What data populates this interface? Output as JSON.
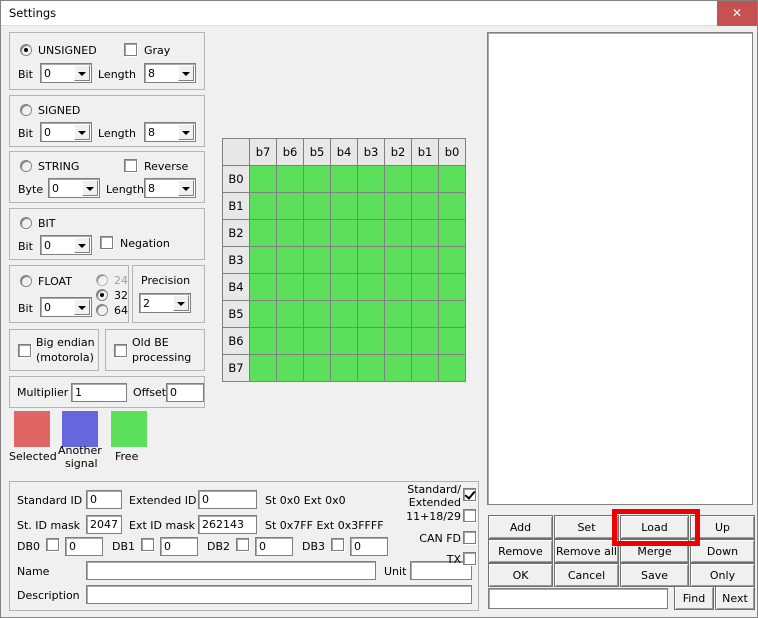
{
  "window": {
    "title": "Settings",
    "close_icon": "close-icon",
    "close_label": "✕"
  },
  "signal_types": {
    "unsigned": {
      "label": "UNSIGNED",
      "selected": true,
      "bit_label": "Bit",
      "bit_value": "0",
      "length_label": "Length",
      "length_value": "8",
      "gray_label": "Gray",
      "gray_checked": false
    },
    "signed": {
      "label": "SIGNED",
      "selected": false,
      "bit_label": "Bit",
      "bit_value": "0",
      "length_label": "Length",
      "length_value": "8"
    },
    "string": {
      "label": "STRING",
      "selected": false,
      "byte_label": "Byte",
      "byte_value": "0",
      "length_label": "Length",
      "length_value": "8",
      "reverse_label": "Reverse",
      "reverse_checked": false
    },
    "bit": {
      "label": "BIT",
      "selected": false,
      "bit_label": "Bit",
      "bit_value": "0",
      "negation_label": "Negation",
      "negation_checked": false
    },
    "float": {
      "label": "FLOAT",
      "selected": false,
      "bit_label": "Bit",
      "bit_value": "0",
      "width_options": [
        "24",
        "32",
        "64"
      ],
      "width_selected": "32",
      "width_24_disabled": true,
      "precision_label": "Precision",
      "precision_value": "2"
    }
  },
  "endian": {
    "big_endian_label": "Big endian (motorola)",
    "big_endian_line1": "Big endian",
    "big_endian_line2": "(motorola)",
    "big_endian_checked": false,
    "old_be_label": "Old BE processing",
    "old_be_line1": "Old BE",
    "old_be_line2": "processing",
    "old_be_checked": false
  },
  "scaling": {
    "multiplier_label": "Multiplier",
    "multiplier_value": "1",
    "offset_label": "Offset",
    "offset_value": "0"
  },
  "legend": [
    {
      "label": "Selected",
      "color": "#e06565"
    },
    {
      "label": "Another signal",
      "line1": "Another",
      "line2": "signal",
      "color": "#6666dd"
    },
    {
      "label": "Free",
      "color": "#5ce05c"
    }
  ],
  "bit_grid": {
    "column_headers": [
      "b7",
      "b6",
      "b5",
      "b4",
      "b3",
      "b2",
      "b1",
      "b0"
    ],
    "row_headers": [
      "B0",
      "B1",
      "B2",
      "B3",
      "B4",
      "B5",
      "B6",
      "B7"
    ],
    "cell_state": "free",
    "free_color": "#5ce05c"
  },
  "identifiers": {
    "standard_id_label": "Standard ID",
    "standard_id_value": "0",
    "extended_id_label": "Extended ID",
    "extended_id_value": "0",
    "id_hex_text": "St 0x0 Ext 0x0",
    "st_id_mask_label": "St. ID mask",
    "st_id_mask_value": "2047",
    "ext_id_mask_label": "Ext ID mask",
    "ext_id_mask_value": "262143",
    "mask_hex_text": "St 0x7FF Ext 0x3FFFF"
  },
  "data_bytes": [
    {
      "label": "DB0",
      "checked": false,
      "value": "0"
    },
    {
      "label": "DB1",
      "checked": false,
      "value": "0"
    },
    {
      "label": "DB2",
      "checked": false,
      "value": "0"
    },
    {
      "label": "DB3",
      "checked": false,
      "value": "0"
    }
  ],
  "frame_flags": [
    {
      "label": "Standard/ Extended",
      "line1": "Standard/",
      "line2": "Extended",
      "checked": true
    },
    {
      "label": "11+18/29",
      "line1": "11+18/29",
      "line2": "",
      "checked": false
    },
    {
      "label": "CAN FD",
      "line1": "CAN FD",
      "line2": "",
      "checked": false
    },
    {
      "label": "TX",
      "line1": "TX",
      "line2": "",
      "checked": false
    }
  ],
  "fields": {
    "name_label": "Name",
    "name_value": "",
    "unit_label": "Unit",
    "unit_value": "",
    "description_label": "Description",
    "description_value": ""
  },
  "actions": {
    "add": "Add",
    "set": "Set",
    "load": "Load",
    "up": "Up",
    "remove": "Remove",
    "remove_all": "Remove all",
    "merge": "Merge",
    "down": "Down",
    "ok": "OK",
    "cancel": "Cancel",
    "save": "Save",
    "only": "Only",
    "find": "Find",
    "next": "Next",
    "search_value": ""
  },
  "highlight": {
    "target": "load",
    "color": "#ee0000"
  },
  "signal_list": {
    "items": []
  }
}
